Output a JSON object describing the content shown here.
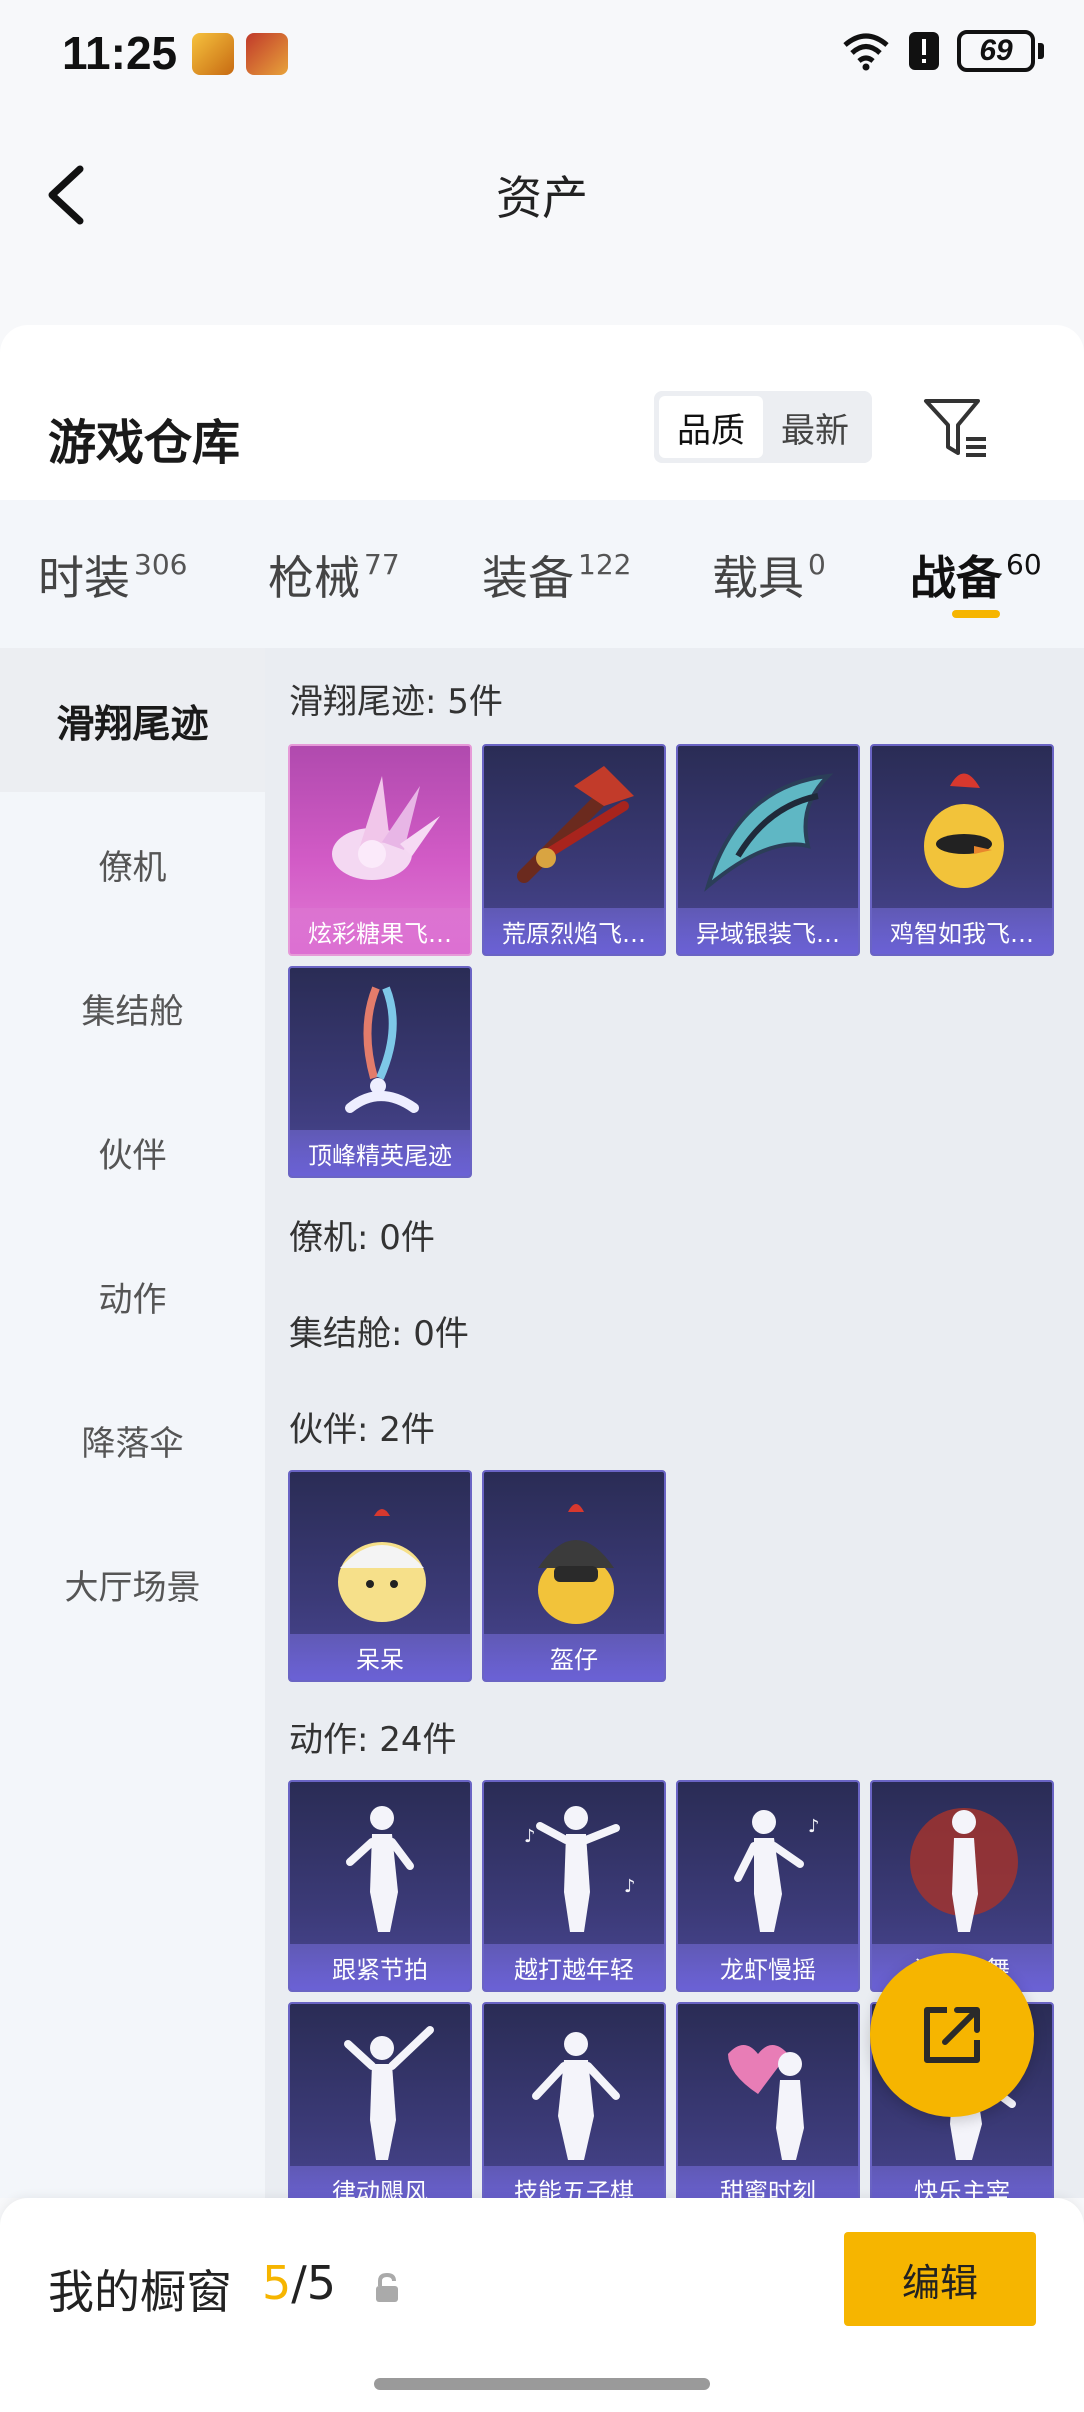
{
  "status_bar": {
    "time": "11:25",
    "battery": "69",
    "icons": [
      "wifi-icon",
      "alert-icon",
      "battery-icon"
    ]
  },
  "nav": {
    "title": "资产",
    "back_icon": "chevron-left-icon"
  },
  "warehouse": {
    "title": "游戏仓库",
    "sort_options": [
      "品质",
      "最新"
    ],
    "selected_sort": "品质",
    "filter_icon": "filter-icon"
  },
  "tabs": [
    {
      "label": "时装",
      "count": "306"
    },
    {
      "label": "枪械",
      "count": "77"
    },
    {
      "label": "装备",
      "count": "122"
    },
    {
      "label": "载具",
      "count": "0"
    },
    {
      "label": "战备",
      "count": "60",
      "active": true
    }
  ],
  "sidebar": {
    "items": [
      {
        "label": "滑翔尾迹",
        "active": true
      },
      {
        "label": "僚机"
      },
      {
        "label": "集结舱"
      },
      {
        "label": "伙伴"
      },
      {
        "label": "动作"
      },
      {
        "label": "降落伞"
      },
      {
        "label": "大厅场景"
      }
    ]
  },
  "sections": {
    "glide_trail": {
      "label": "滑翔尾迹: 5件",
      "items": [
        "炫彩糖果飞…",
        "荒原烈焰飞…",
        "异域银装飞…",
        "鸡智如我飞…",
        "顶峰精英尾迹"
      ]
    },
    "wingman": {
      "label": "僚机: 0件"
    },
    "rally_pod": {
      "label": "集结舱: 0件"
    },
    "companion": {
      "label": "伙伴: 2件",
      "items": [
        "呆呆",
        "盔仔"
      ]
    },
    "emote": {
      "label": "动作: 24件",
      "items": [
        "跟紧节拍",
        "越打越年轻",
        "龙虾慢摇",
        "浪漫炫舞",
        "律动飓风",
        "技能五子棋",
        "甜蜜时刻",
        "快乐主宰"
      ]
    }
  },
  "bottom_bar": {
    "label": "我的橱窗",
    "current": "5",
    "separator": "/",
    "total": "5",
    "edit_label": "编辑",
    "lock_icon": "lock-icon"
  },
  "colors": {
    "accent": "#f6b500",
    "card_purple": "#3b3a77",
    "card_pink": "#d25bc6"
  }
}
